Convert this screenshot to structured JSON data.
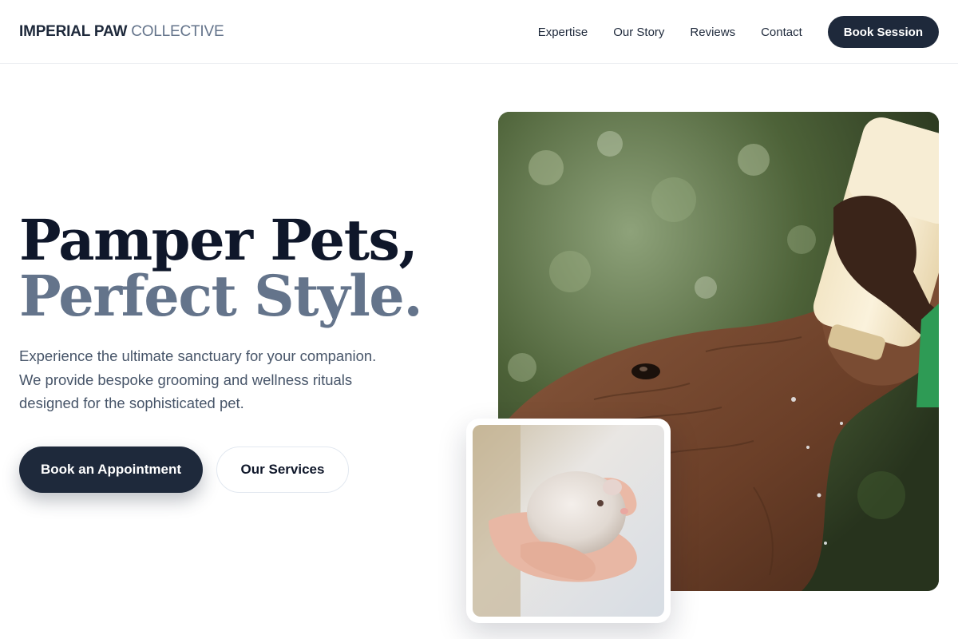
{
  "header": {
    "logo_strong": "IMPERIAL PAW",
    "logo_light": "COLLECTIVE",
    "nav": [
      {
        "label": "Expertise"
      },
      {
        "label": "Our Story"
      },
      {
        "label": "Reviews"
      },
      {
        "label": "Contact"
      }
    ],
    "cta_label": "Book Session"
  },
  "hero": {
    "title_line1": "Pamper Pets,",
    "title_line2": "Perfect Style.",
    "description": "Experience the ultimate sanctuary for your companion. We provide bespoke grooming and wellness rituals designed for the sophisticated pet.",
    "primary_button": "Book an Appointment",
    "secondary_button": "Our Services",
    "main_image_icon": "elephant-feeding-photo",
    "inset_image_icon": "hamster-in-hand-photo"
  },
  "colors": {
    "primary": "#1e293b",
    "muted": "#64748b",
    "text": "#0f172a",
    "body_text": "#475569",
    "border": "#e2e8f0"
  }
}
